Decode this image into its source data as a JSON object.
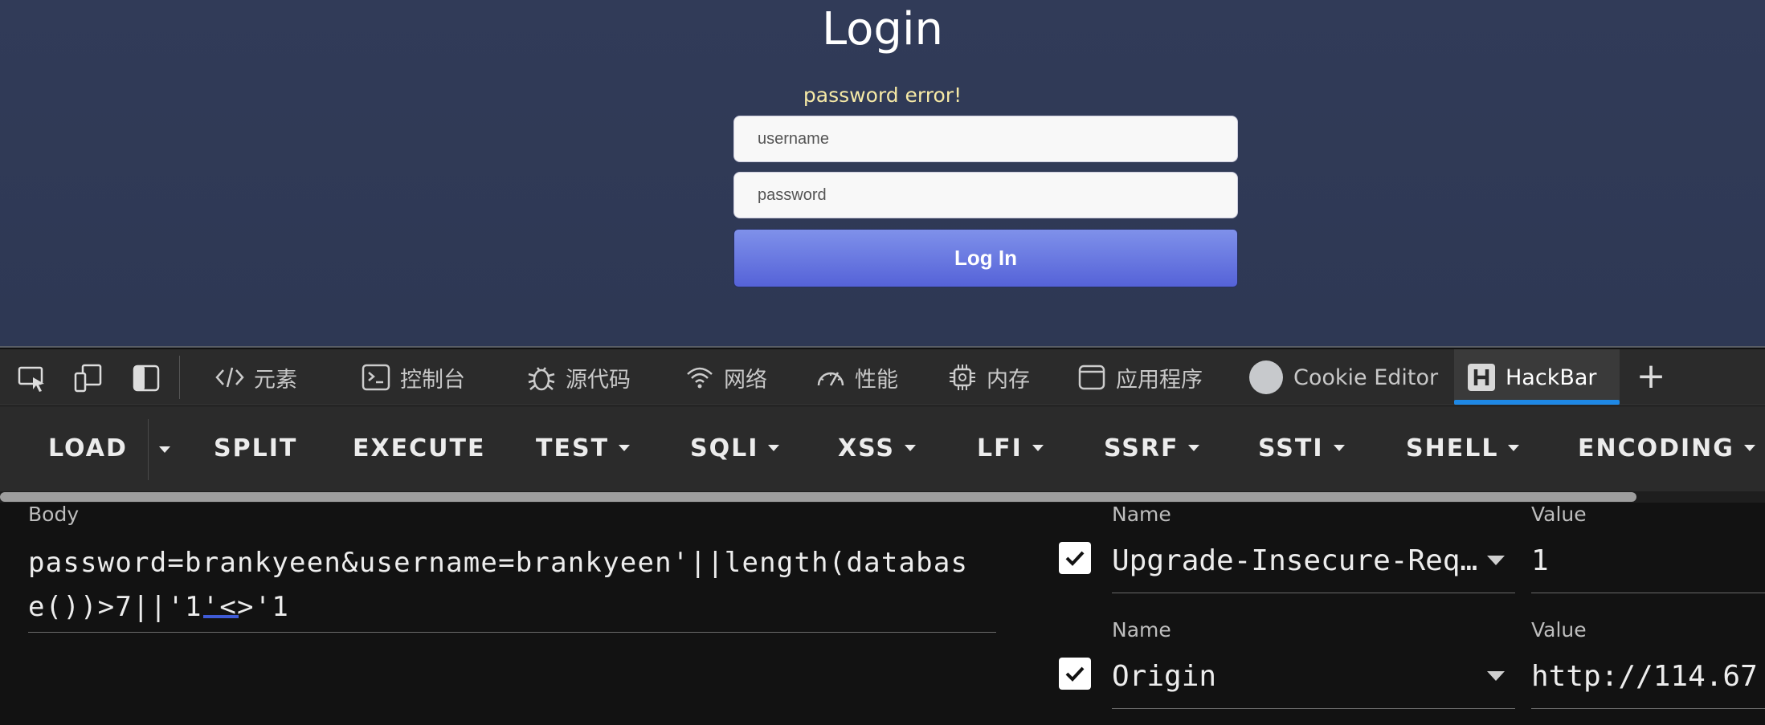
{
  "page": {
    "title": "Login",
    "message": "password error!",
    "username_placeholder": "username",
    "password_placeholder": "password",
    "login_button": "Log In"
  },
  "devtools": {
    "tabs": [
      {
        "label": "元素",
        "icon": "code-icon"
      },
      {
        "label": "控制台",
        "icon": "console-icon"
      },
      {
        "label": "源代码",
        "icon": "bug-icon"
      },
      {
        "label": "网络",
        "icon": "wifi-icon"
      },
      {
        "label": "性能",
        "icon": "gauge-icon"
      },
      {
        "label": "内存",
        "icon": "chip-icon"
      },
      {
        "label": "应用程序",
        "icon": "app-window-icon"
      },
      {
        "label": "Cookie Editor",
        "icon": "cookie-icon"
      },
      {
        "label": "HackBar",
        "icon": "hackbar-icon",
        "active": true
      }
    ],
    "active_color": "#1e88e5"
  },
  "hackbar": {
    "buttons": [
      "LOAD",
      "SPLIT",
      "EXECUTE",
      "TEST",
      "SQLI",
      "XSS",
      "LFI",
      "SSRF",
      "SSTI",
      "SHELL",
      "ENCODING"
    ],
    "body_label": "Body",
    "body_value": "password=brankyeen&username=brankyeen'||length(database())>7||'1'<>'1",
    "headers": [
      {
        "name_label": "Name",
        "value_label": "Value",
        "name": "Upgrade-Insecure-Requests",
        "value": "1",
        "checked": true
      },
      {
        "name_label": "Name",
        "value_label": "Value",
        "name": "Origin",
        "value": "http://114.67",
        "checked": true
      }
    ]
  }
}
